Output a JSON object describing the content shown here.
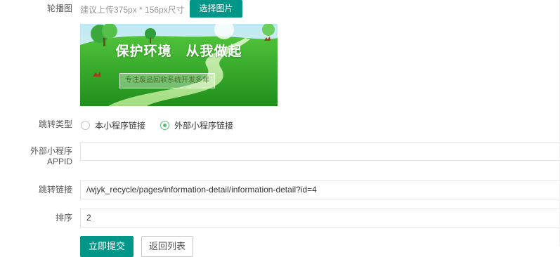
{
  "carousel": {
    "label": "轮播图",
    "hint": "建议上传375px * 156px尺寸",
    "select_button": "选择图片",
    "banner_title": "保护环境　从我做起",
    "banner_tagline": "专注废品回收系统开发多年"
  },
  "jump_type": {
    "label": "跳转类型",
    "options": [
      "本小程序链接",
      "外部小程序链接"
    ],
    "selected_index": 1
  },
  "external_appid": {
    "label_line1": "外部小程序",
    "label_line2": "APPID",
    "value": ""
  },
  "jump_link": {
    "label": "跳转链接",
    "value": "/wjyk_recycle/pages/information-detail/information-detail?id=4"
  },
  "sort": {
    "label": "排序",
    "value": "2"
  },
  "actions": {
    "submit": "立即提交",
    "back": "返回列表"
  },
  "colors": {
    "primary": "#009688",
    "radio_checked": "#5fb878"
  }
}
